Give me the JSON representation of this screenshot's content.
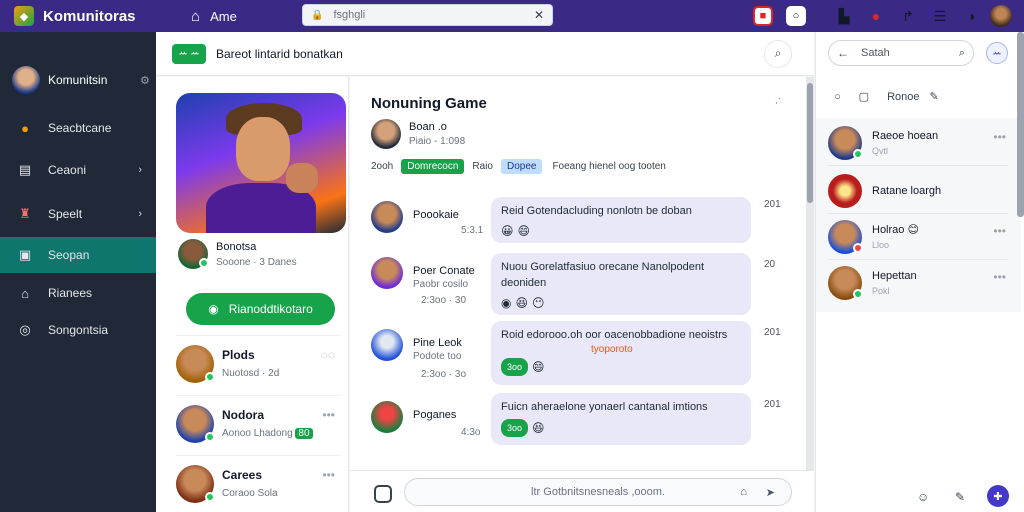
{
  "topbar": {
    "app_title": "Komunitoras",
    "home_label": "Ame",
    "search_value": "fsghgli",
    "avatar_name": "user-avatar"
  },
  "leftnav": {
    "user_name": "Komunitsin",
    "items": [
      {
        "label": "Seacbtcane",
        "icon": "coin-icon",
        "chevron": false
      },
      {
        "label": "Ceaoni",
        "icon": "inbox-icon",
        "chevron": true
      },
      {
        "label": "Speelt",
        "icon": "character-icon",
        "chevron": true
      },
      {
        "label": "Seopan",
        "icon": "game-icon",
        "chevron": false,
        "active": true
      },
      {
        "label": "Rianees",
        "icon": "home-icon",
        "chevron": false
      },
      {
        "label": "Songontsia",
        "icon": "settings-icon",
        "chevron": false
      }
    ]
  },
  "middle_header": {
    "pill": "ꕀ ꕀ",
    "title": "Bareot lintarid bonatkan"
  },
  "game": {
    "author_name": "Bonotsa",
    "author_sub": "Sooone · 3 Danes",
    "follow_label": "Rianoddtikotaro",
    "friends": [
      {
        "name": "Plods",
        "sub": "Nuotosd · 2d",
        "avatar": "#a16207"
      },
      {
        "name": "Nodora",
        "sub": "Aonoo Lhadong",
        "badge": "80",
        "avatar": "#1e40af"
      },
      {
        "name": "Carees",
        "sub": "Coraoo Sola",
        "avatar": "#7c2d12"
      }
    ]
  },
  "feed": {
    "title": "Nonuning Game",
    "author_name": "Boan .o",
    "author_sub": "Piaio - 1:098",
    "date": "2ooh",
    "tag_green": "Domrecocn",
    "tag_plain": "Raio",
    "tag_blue": "Dopee",
    "tag_desc": "Foeang hienel oog tooten",
    "messages": [
      {
        "name": "Poookaie",
        "sub": "5:3.1",
        "text": "Reid Gotendacluding nonlotn be doban",
        "ts": "201",
        "avatar": "#1e3a8a"
      },
      {
        "name": "Poer Conate",
        "sub": "Paobr cosilo",
        "sub2": "2:3oo · 30",
        "text": "Nuou Gorelatfasiuo orecane Nanolpodent deoniden",
        "ts": "20",
        "avatar": "#6d28d9"
      },
      {
        "name": "Pine Leok",
        "sub": "Podote too",
        "sub2": "2:3oo · 3o",
        "text": "Roid edorooo.oh oor oacenobbadione neoistrs",
        "orange": "tyoporoto",
        "reply": "3oo",
        "ts": "201",
        "avatar": "#1d4ed8"
      },
      {
        "name": "Poganes",
        "sub": "4:3o",
        "text": "Fuicn aheraelone yonaerl cantanal imtions",
        "reply": "3oo",
        "ts": "201",
        "avatar": "#15803d"
      }
    ],
    "composer_placeholder": "ltr Gotbnitsnesneals ,ooom."
  },
  "right": {
    "search_value": "Satah",
    "badge": "ꕀ",
    "tools_label": "Ronoe",
    "list": [
      {
        "name": "Raeoe hoean",
        "sub": "Qvtl",
        "avatar": "#1e3a8a",
        "online": true
      },
      {
        "name": "Ratane loargh",
        "sub": "",
        "avatar": "#b91c1c",
        "online": false
      },
      {
        "name": "Holrao",
        "sub": "Lloo",
        "avatar": "#1d4ed8",
        "online": false,
        "emoji": true
      },
      {
        "name": "Hepettan",
        "sub": "Pokl",
        "avatar": "#854d0e",
        "online": true
      }
    ]
  }
}
